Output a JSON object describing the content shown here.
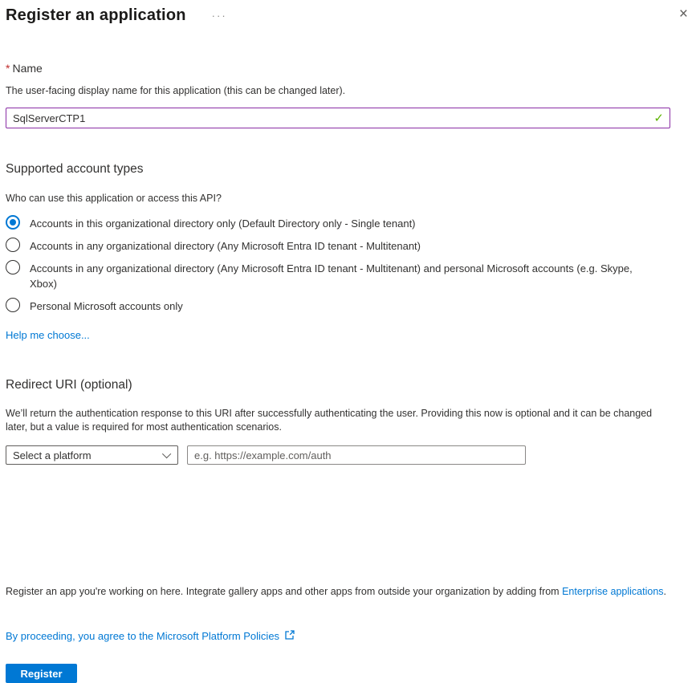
{
  "header": {
    "title": "Register an application",
    "ellipsis_glyph": "···",
    "close_glyph": "×"
  },
  "name_section": {
    "required_marker": "*",
    "label": "Name",
    "description": "The user-facing display name for this application (this can be changed later).",
    "value": "SqlServerCTP1",
    "valid_check_glyph": "✓"
  },
  "account_types": {
    "heading": "Supported account types",
    "question": "Who can use this application or access this API?",
    "options": [
      {
        "label": "Accounts in this organizational directory only (Default Directory only - Single tenant)",
        "selected": true
      },
      {
        "label": "Accounts in any organizational directory (Any Microsoft Entra ID tenant - Multitenant)",
        "selected": false
      },
      {
        "label": "Accounts in any organizational directory (Any Microsoft Entra ID tenant - Multitenant) and personal Microsoft accounts (e.g. Skype, Xbox)",
        "selected": false
      },
      {
        "label": "Personal Microsoft accounts only",
        "selected": false
      }
    ],
    "help_link": "Help me choose..."
  },
  "redirect_section": {
    "heading": "Redirect URI (optional)",
    "description": "We’ll return the authentication response to this URI after successfully authenticating the user. Providing this now is optional and it can be changed later, but a value is required for most authentication scenarios.",
    "platform_select_value": "Select a platform",
    "uri_placeholder": "e.g. https://example.com/auth"
  },
  "footer": {
    "register_note_prefix": "Register an app you're working on here. Integrate gallery apps and other apps from outside your organization by adding from ",
    "enterprise_link": "Enterprise applications",
    "register_note_suffix": ".",
    "policy_link_text": "By proceeding, you agree to the Microsoft Platform Policies",
    "register_button": "Register"
  },
  "colors": {
    "accent_blue": "#0078d4",
    "dirty_field_purple": "#8a2da5",
    "valid_green": "#5db300",
    "required_red": "#c02b2b",
    "text_dark": "#323130"
  }
}
